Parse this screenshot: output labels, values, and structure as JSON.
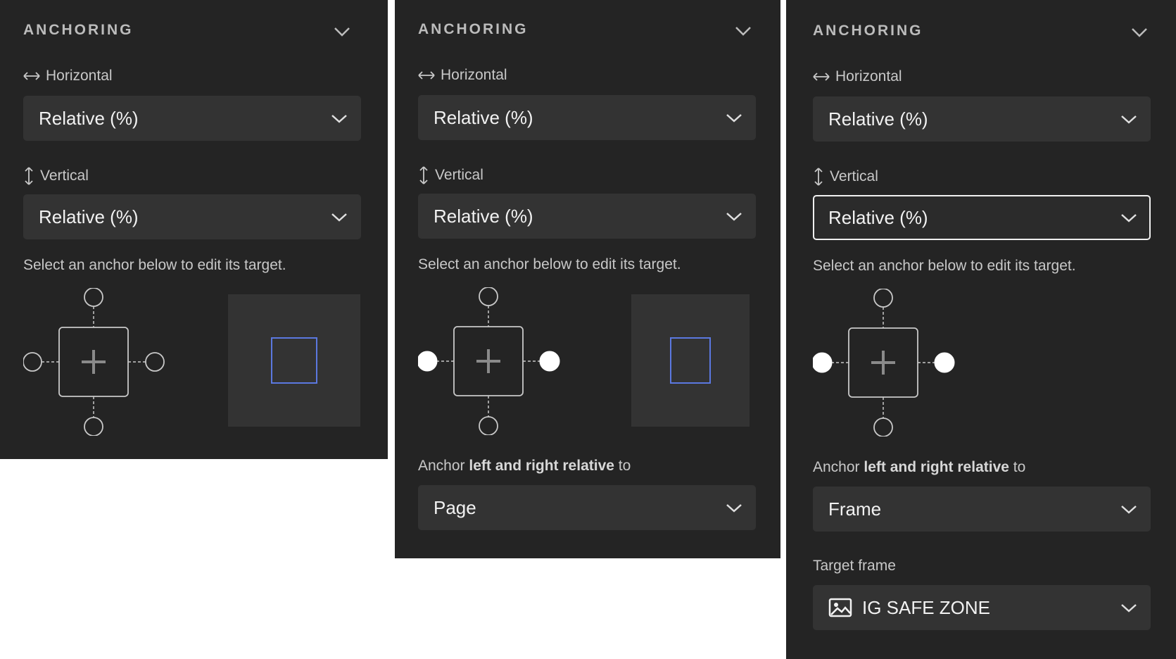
{
  "colors": {
    "panel_bg": "#242424",
    "field_bg": "#333333",
    "accent_blue": "#5b78e0",
    "focus_border": "#f0f0f0"
  },
  "icons": {
    "collapse": "chevron-down-icon",
    "horizontal": "horizontal-arrows-icon",
    "vertical": "vertical-arrows-icon",
    "dropdown": "chevron-down-icon",
    "center": "plus-icon",
    "frame": "image-icon"
  },
  "panels": [
    {
      "title": "ANCHORING",
      "horizontal_label": "Horizontal",
      "horizontal_value": "Relative (%)",
      "vertical_label": "Vertical",
      "vertical_value": "Relative (%)",
      "help": "Select an anchor below to edit its target.",
      "anchors_selected": {
        "top": false,
        "bottom": false,
        "left": false,
        "right": false
      }
    },
    {
      "title": "ANCHORING",
      "horizontal_label": "Horizontal",
      "horizontal_value": "Relative (%)",
      "vertical_label": "Vertical",
      "vertical_value": "Relative (%)",
      "help": "Select an anchor below to edit its target.",
      "anchors_selected": {
        "top": false,
        "bottom": false,
        "left": true,
        "right": true
      },
      "relative_prefix": "Anchor",
      "relative_bold": "left and right relative",
      "relative_suffix": "to",
      "relative_value": "Page"
    },
    {
      "title": "ANCHORING",
      "horizontal_label": "Horizontal",
      "horizontal_value": "Relative (%)",
      "vertical_label": "Vertical",
      "vertical_value": "Relative (%)",
      "help": "Select an anchor below to edit its target.",
      "anchors_selected": {
        "top": false,
        "bottom": false,
        "left": true,
        "right": true
      },
      "relative_prefix": "Anchor",
      "relative_bold": "left and right relative",
      "relative_suffix": "to",
      "relative_value": "Frame",
      "target_label": "Target frame",
      "target_value": "IG SAFE ZONE"
    }
  ]
}
